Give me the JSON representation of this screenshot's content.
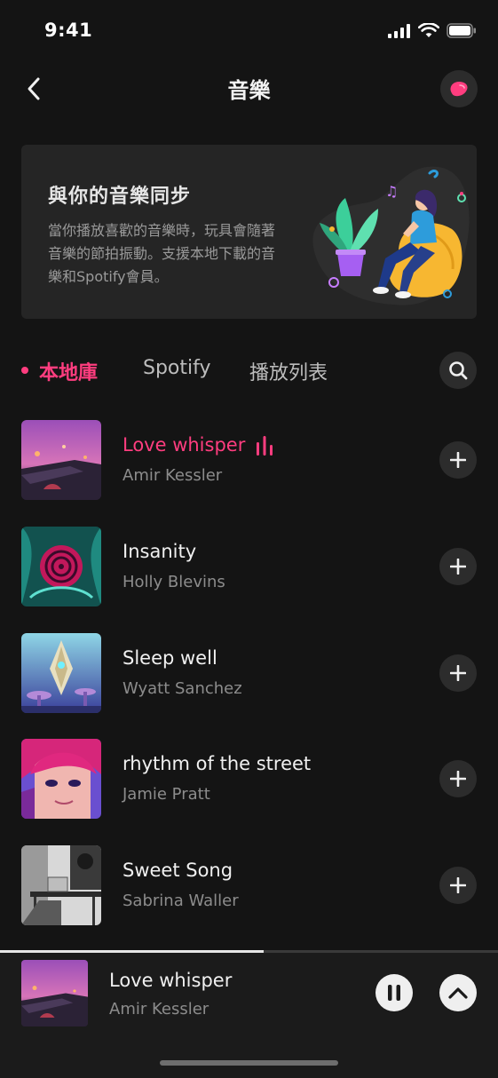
{
  "status_bar": {
    "time": "9:41",
    "icons": [
      "cellular-signal-icon",
      "wifi-icon",
      "battery-icon"
    ]
  },
  "header": {
    "title": "音樂",
    "back_icon": "chevron-left-icon",
    "device_icon": "toy-device-icon"
  },
  "sync_banner": {
    "title": "與你的音樂同步",
    "description": "當你播放喜歡的音樂時，玩具會隨著音樂的節拍振動。支援本地下載的音樂和Spotify會員。",
    "illustration": "woman-on-beanbag-listening-music-illustration"
  },
  "tabs": [
    {
      "label": "本地庫",
      "active": true
    },
    {
      "label": "Spotify",
      "active": false
    },
    {
      "label": "播放列表",
      "active": false
    }
  ],
  "search_icon": "search-icon",
  "tracks": [
    {
      "title": "Love whisper",
      "artist": "Amir Kessler",
      "playing": true
    },
    {
      "title": "Insanity",
      "artist": "Holly Blevins",
      "playing": false
    },
    {
      "title": "Sleep well",
      "artist": "Wyatt Sanchez",
      "playing": false
    },
    {
      "title": "rhythm of the street",
      "artist": "Jamie Pratt",
      "playing": false
    },
    {
      "title": "Sweet Song",
      "artist": "Sabrina Waller",
      "playing": false
    }
  ],
  "mini_player": {
    "title": "Love whisper",
    "artist": "Amir Kessler",
    "progress": 0.53
  },
  "colors": {
    "accent": "#ff3d7f",
    "background": "#141414",
    "card": "#252525",
    "button": "#2c2c2c"
  }
}
